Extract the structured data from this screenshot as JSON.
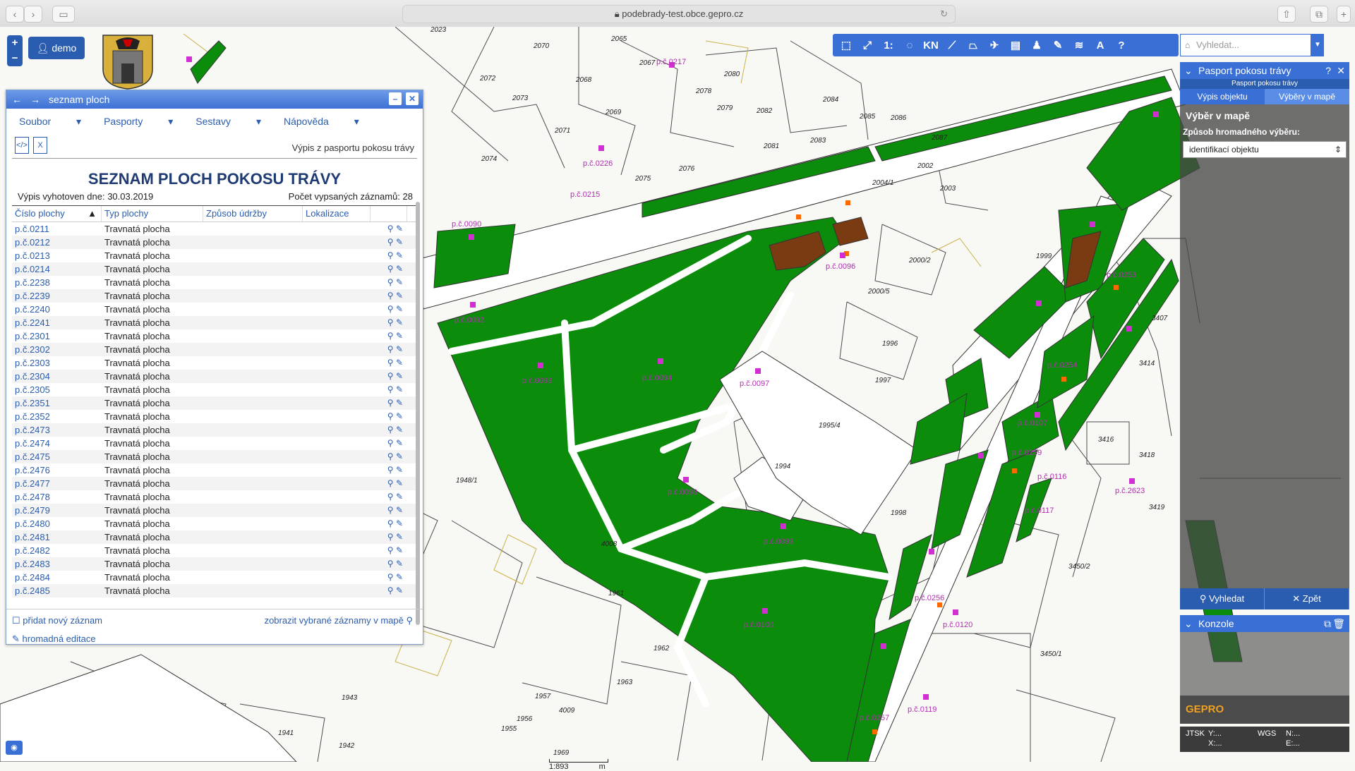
{
  "browser": {
    "url": "podebrady-test.obce.gepro.cz"
  },
  "map": {
    "parcel_numbers": [
      "2023",
      "2070",
      "2065",
      "2067",
      "2068",
      "2072",
      "2073",
      "2069",
      "2071",
      "2074",
      "2076",
      "2075",
      "2078",
      "2079",
      "2082",
      "2080",
      "2081",
      "2083",
      "2084",
      "2085",
      "2086",
      "2087",
      "2004/1",
      "2002",
      "2003",
      "2000/2",
      "2000/5",
      "1999",
      "1996",
      "1997",
      "1995/4",
      "1994",
      "1998",
      "1948/1",
      "4008",
      "1961",
      "1962",
      "1963",
      "1943",
      "1941",
      "1942",
      "3450/2",
      "3450/1",
      "3416",
      "3418",
      "3414",
      "3407",
      "3419",
      "1957",
      "1955",
      "1956",
      "4009",
      "1969"
    ],
    "plot_labels": [
      "p.č.0090",
      "p.č.0092",
      "p.č.0093",
      "p.č.0094",
      "p.č.0096",
      "p.č.0097",
      "p.č.0098",
      "p.č.0099",
      "p.č.0100",
      "p.č.0107",
      "p.č.0116",
      "p.č.0117",
      "p.č.0119",
      "p.č.0120",
      "p.č.0254",
      "p.č.0256",
      "p.č.0257",
      "p.č.0259",
      "p.č.2623",
      "p.č.0226",
      "p.č.0215",
      "p.č.0217",
      "p.č.0253"
    ],
    "scale_text": "1:893",
    "scale_units": "m"
  },
  "user": {
    "name": "demo"
  },
  "toolbar": {
    "search_placeholder": "Vyhledat...",
    "tools": [
      "zoom-box-icon",
      "zoom-extent-icon",
      "scale-icon",
      "lasso-icon",
      "kn-icon",
      "measure-line-icon",
      "measure-area-icon",
      "pin-icon",
      "print-icon",
      "person-icon",
      "pencil-icon",
      "layers-icon",
      "text-icon",
      "help-icon"
    ],
    "kn_label": "KN",
    "one_label": "1:"
  },
  "panel": {
    "title": "seznam ploch",
    "menu": [
      "Soubor",
      "Pasporty",
      "Sestavy",
      "Nápověda"
    ],
    "export_hint": "Výpis z pasportu pokosu trávy",
    "report_title": "SEZNAM PLOCH POKOSU TRÁVY",
    "generated": "Výpis vyhotoven dne: 30.03.2019",
    "count": "Počet vypsaných záznamů: 28",
    "columns": [
      "Číslo plochy",
      "Typ plochy",
      "Způsob údržby",
      "Lokalizace"
    ],
    "rows": [
      [
        "p.č.0211",
        "Travnatá plocha"
      ],
      [
        "p.č.0212",
        "Travnatá plocha"
      ],
      [
        "p.č.0213",
        "Travnatá plocha"
      ],
      [
        "p.č.0214",
        "Travnatá plocha"
      ],
      [
        "p.č.2238",
        "Travnatá plocha"
      ],
      [
        "p.č.2239",
        "Travnatá plocha"
      ],
      [
        "p.č.2240",
        "Travnatá plocha"
      ],
      [
        "p.č.2241",
        "Travnatá plocha"
      ],
      [
        "p.č.2301",
        "Travnatá plocha"
      ],
      [
        "p.č.2302",
        "Travnatá plocha"
      ],
      [
        "p.č.2303",
        "Travnatá plocha"
      ],
      [
        "p.č.2304",
        "Travnatá plocha"
      ],
      [
        "p.č.2305",
        "Travnatá plocha"
      ],
      [
        "p.č.2351",
        "Travnatá plocha"
      ],
      [
        "p.č.2352",
        "Travnatá plocha"
      ],
      [
        "p.č.2473",
        "Travnatá plocha"
      ],
      [
        "p.č.2474",
        "Travnatá plocha"
      ],
      [
        "p.č.2475",
        "Travnatá plocha"
      ],
      [
        "p.č.2476",
        "Travnatá plocha"
      ],
      [
        "p.č.2477",
        "Travnatá plocha"
      ],
      [
        "p.č.2478",
        "Travnatá plocha"
      ],
      [
        "p.č.2479",
        "Travnatá plocha"
      ],
      [
        "p.č.2480",
        "Travnatá plocha"
      ],
      [
        "p.č.2481",
        "Travnatá plocha"
      ],
      [
        "p.č.2482",
        "Travnatá plocha"
      ],
      [
        "p.č.2483",
        "Travnatá plocha"
      ],
      [
        "p.č.2484",
        "Travnatá plocha"
      ],
      [
        "p.č.2485",
        "Travnatá plocha"
      ]
    ],
    "add_record": "přidat nový záznam",
    "show_selected": "zobrazit vybrané záznamy v mapě",
    "bulk_edit": "hromadná editace"
  },
  "right_panel": {
    "title": "Pasport pokosu trávy",
    "subtitle": "Pasport pokosu trávy",
    "tabs": [
      "Výpis objektu",
      "Výběry v mapě"
    ],
    "section": "Výběr v mapě",
    "method_label": "Způsob hromadného výběru:",
    "method_value": "identifikací objektu",
    "search_button": "Vyhledat",
    "back_button": "Zpět"
  },
  "console": {
    "title": "Konzole"
  },
  "brand": {
    "name": "GEPRO"
  },
  "coords": {
    "jtsk": "JTSK",
    "y": "Y:...",
    "x": "X:...",
    "wgs": "WGS",
    "n": "N:...",
    "e": "E:..."
  },
  "colors": {
    "accent": "#3a70d6",
    "grass": "#0b8c0b",
    "soil": "#7a3b13",
    "plot_label": "#b02fb0"
  }
}
